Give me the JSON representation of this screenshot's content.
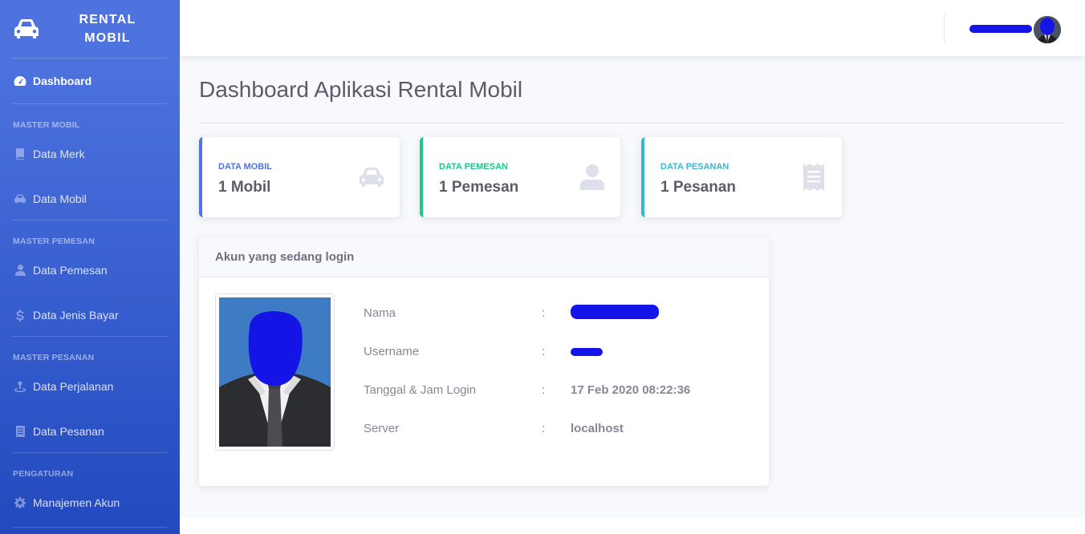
{
  "brand": {
    "line1": "RENTAL",
    "line2": "MOBIL",
    "icon": "car-icon"
  },
  "sidebar": {
    "dashboard": {
      "label": "Dashboard",
      "icon": "tachometer-icon"
    },
    "sections": [
      {
        "heading": "MASTER MOBIL",
        "items": [
          {
            "label": "Data Merk",
            "icon": "book-icon"
          },
          {
            "label": "Data Mobil",
            "icon": "car-icon"
          }
        ]
      },
      {
        "heading": "MASTER PEMESAN",
        "items": [
          {
            "label": "Data Pemesan",
            "icon": "user-icon"
          },
          {
            "label": "Data Jenis Bayar",
            "icon": "dollar-icon"
          }
        ]
      },
      {
        "heading": "MASTER PESANAN",
        "items": [
          {
            "label": "Data Perjalanan",
            "icon": "route-icon"
          },
          {
            "label": "Data Pesanan",
            "icon": "receipt-icon"
          }
        ]
      },
      {
        "heading": "PENGATURAN",
        "items": [
          {
            "label": "Manajemen Akun",
            "icon": "gear-icon"
          }
        ]
      }
    ]
  },
  "page": {
    "title": "Dashboard Aplikasi Rental Mobil"
  },
  "stats": [
    {
      "label": "DATA MOBIL",
      "value": "1 Mobil",
      "color": "#4e73df",
      "icon": "car-icon"
    },
    {
      "label": "DATA PEMESAN",
      "value": "1 Pemesan",
      "color": "#1cc88a",
      "icon": "user-icon"
    },
    {
      "label": "DATA PESANAN",
      "value": "1 Pesanan",
      "color": "#36b9cc",
      "icon": "receipt-icon"
    }
  ],
  "login_card": {
    "title": "Akun yang sedang login",
    "rows": [
      {
        "label": "Nama",
        "colon": ":",
        "value": ""
      },
      {
        "label": "Username",
        "colon": ":",
        "value": ""
      },
      {
        "label": "Tanggal & Jam Login",
        "colon": ":",
        "value": "17 Feb 2020 08:22:36"
      },
      {
        "label": "Server",
        "colon": ":",
        "value": "localhost"
      }
    ]
  },
  "colors": {
    "sidebar_top": "#4e73df",
    "sidebar_bottom": "#224abe",
    "redaction": "#1414e6"
  }
}
